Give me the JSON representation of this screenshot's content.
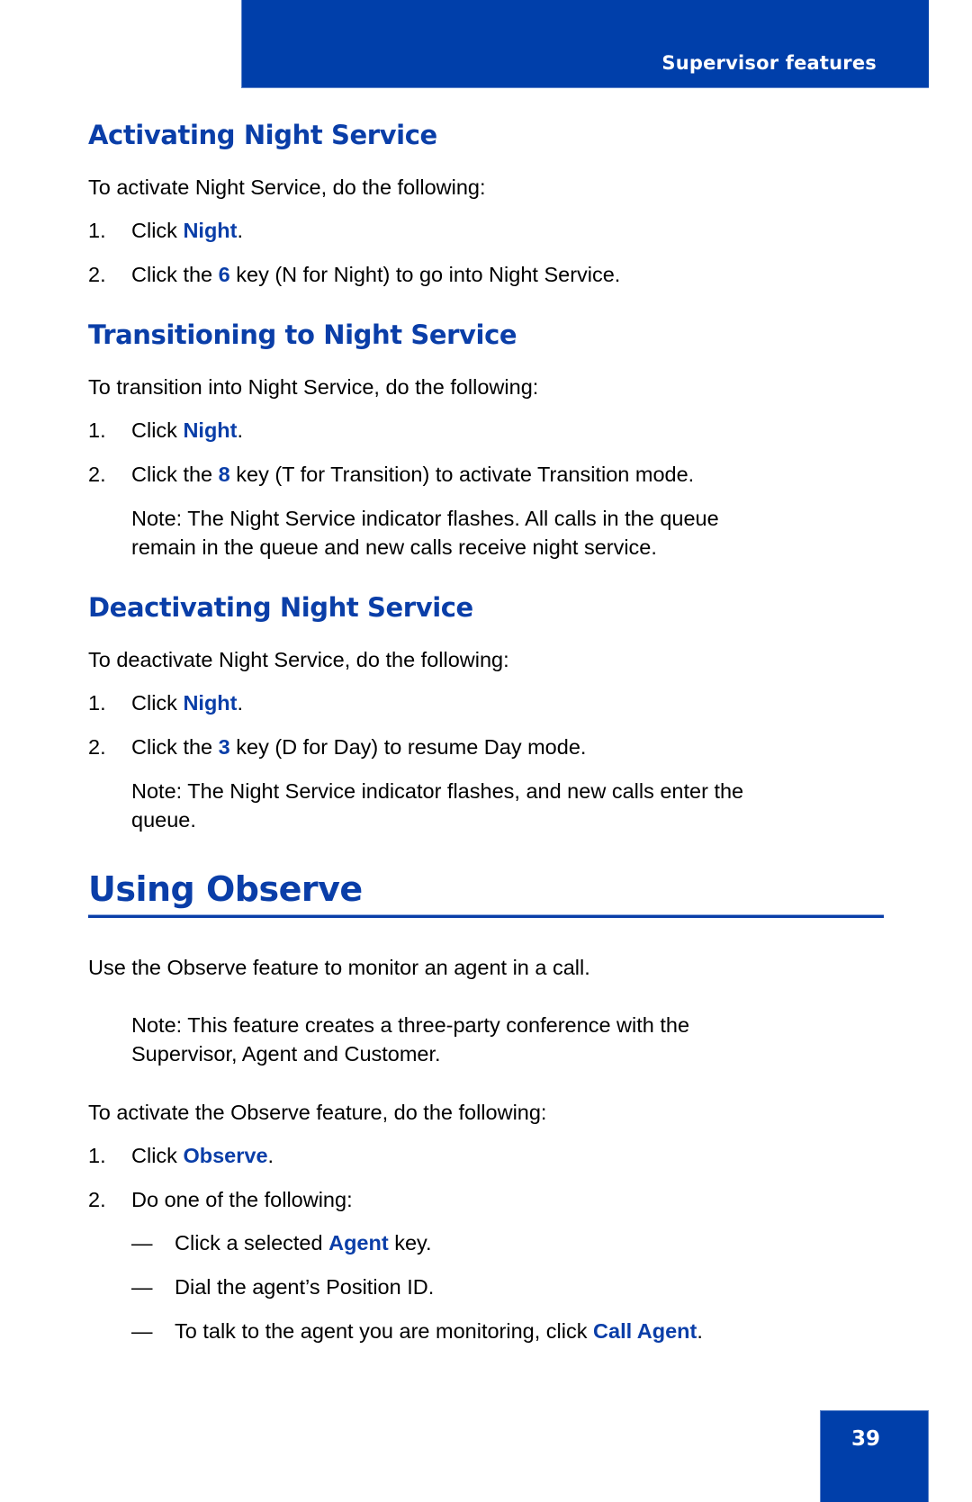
{
  "header": {
    "section_title": "Supervisor features"
  },
  "sections": {
    "activating": {
      "heading": "Activating Night Service",
      "intro": "To activate Night Service, do the following:",
      "steps": [
        {
          "num": "1.",
          "pre": "Click ",
          "key": "Night",
          "post": "."
        },
        {
          "num": "2.",
          "pre": "Click the ",
          "key": "6",
          "post": " key (N for Night) to go into Night Service."
        }
      ]
    },
    "transitioning": {
      "heading": "Transitioning to Night Service",
      "intro": "To transition into Night Service, do the following:",
      "steps": [
        {
          "num": "1.",
          "pre": "Click ",
          "key": "Night",
          "post": "."
        },
        {
          "num": "2.",
          "pre": "Click the ",
          "key": "8",
          "post": " key (T for Transition) to activate Transition mode."
        }
      ],
      "note_lines": [
        "Note:  The Night Service indicator flashes. All calls in the queue",
        "remain in the queue and new calls receive night service."
      ]
    },
    "deactivating": {
      "heading": "Deactivating Night Service",
      "intro": "To deactivate Night Service, do the following:",
      "steps": [
        {
          "num": "1.",
          "pre": "Click ",
          "key": "Night",
          "post": "."
        },
        {
          "num": "2.",
          "pre": "Click the ",
          "key": "3",
          "post": " key (D for Day) to resume Day mode."
        }
      ],
      "note_lines": [
        "Note:  The Night Service indicator flashes, and new calls enter the",
        "queue."
      ]
    },
    "observe": {
      "heading": "Using Observe",
      "intro": "Use the Observe feature to monitor an agent in a call.",
      "note_lines": [
        "Note:  This feature creates a three-party conference with the",
        "Supervisor, Agent and Customer."
      ],
      "activate_intro": "To activate the Observe feature, do the following:",
      "steps": [
        {
          "num": "1.",
          "pre": "Click ",
          "key": "Observe",
          "post": "."
        },
        {
          "num": "2.",
          "pre": "Do one of the following:",
          "key": "",
          "post": ""
        }
      ],
      "options": [
        {
          "dash": "—",
          "pre": "Click a selected ",
          "key": "Agent",
          "post": " key."
        },
        {
          "dash": "—",
          "pre": "Dial the agent’s Position ID.",
          "key": "",
          "post": ""
        },
        {
          "dash": "—",
          "pre": "To talk to the agent you are monitoring, click ",
          "key": "Call Agent",
          "post": "."
        }
      ]
    }
  },
  "footer": {
    "page_number": "39"
  },
  "colors": {
    "brand_blue": "#003faa",
    "heading_blue": "#0a3ea8",
    "text": "#000000"
  }
}
